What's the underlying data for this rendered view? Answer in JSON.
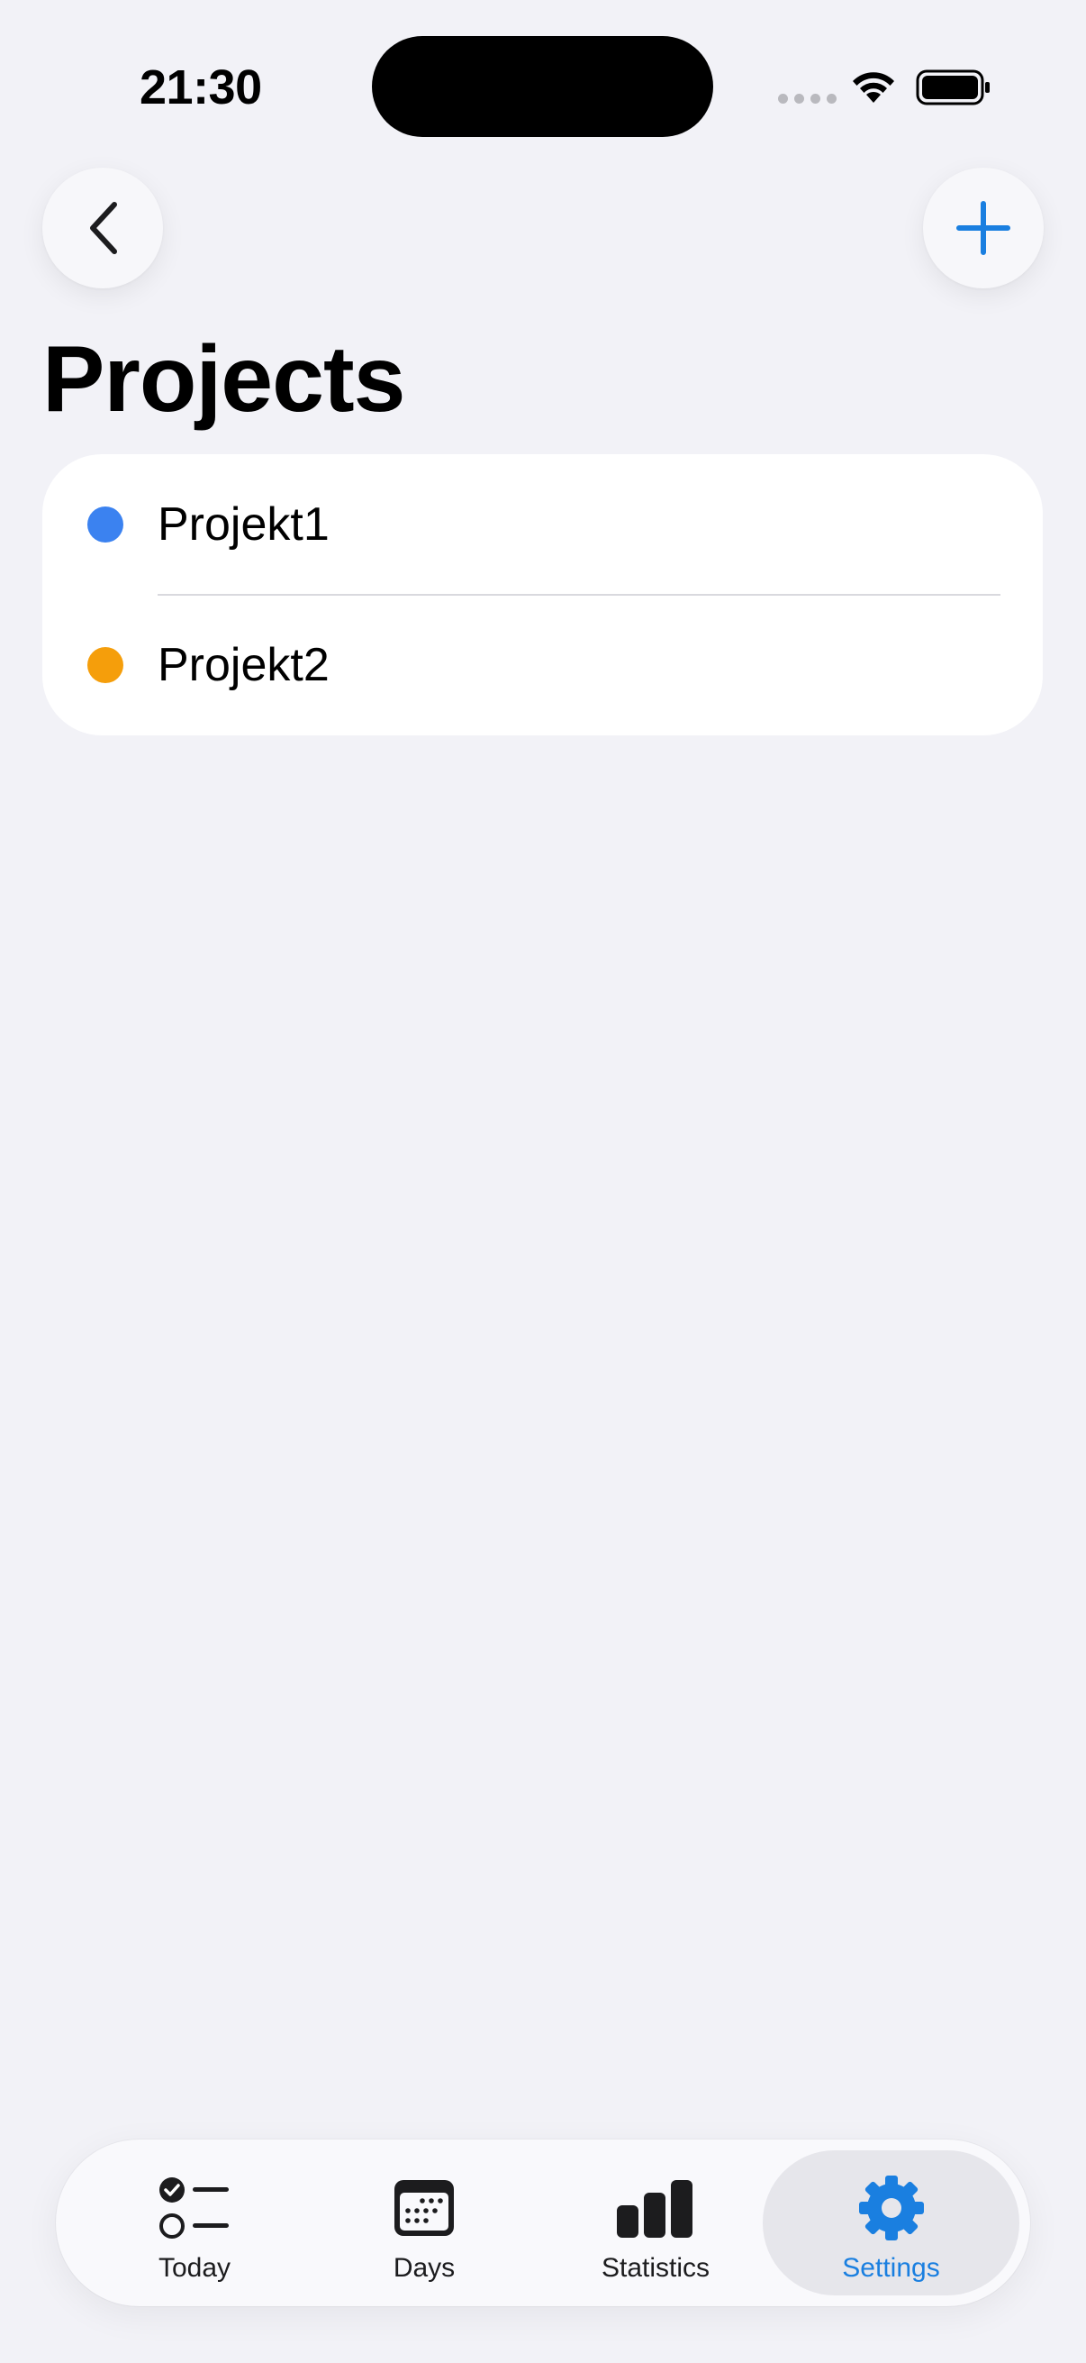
{
  "status_bar": {
    "time": "21:30"
  },
  "nav": {
    "back_icon": "chevron-left-icon",
    "add_icon": "plus-icon",
    "title": "Projects"
  },
  "projects": [
    {
      "name": "Projekt1",
      "color": "#3b82f0"
    },
    {
      "name": "Projekt2",
      "color": "#f59e0b"
    }
  ],
  "tabs": [
    {
      "label": "Today",
      "icon": "checklist-icon",
      "active": false
    },
    {
      "label": "Days",
      "icon": "calendar-icon",
      "active": false
    },
    {
      "label": "Statistics",
      "icon": "bar-chart-icon",
      "active": false
    },
    {
      "label": "Settings",
      "icon": "gear-icon",
      "active": true
    }
  ],
  "colors": {
    "accent": "#1a7fe0",
    "background": "#f2f2f7"
  }
}
